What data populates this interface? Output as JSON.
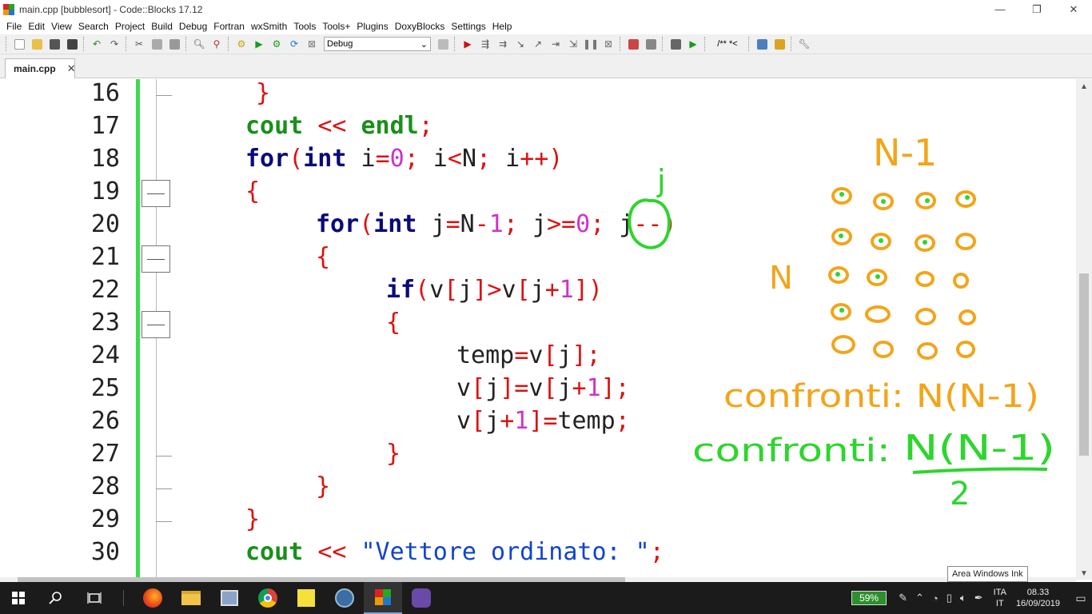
{
  "window": {
    "title": "main.cpp [bubblesort] - Code::Blocks 17.12",
    "minimize": "—",
    "restore": "❐",
    "close": "✕"
  },
  "menu": [
    "File",
    "Edit",
    "View",
    "Search",
    "Project",
    "Build",
    "Debug",
    "Fortran",
    "wxSmith",
    "Tools",
    "Tools+",
    "Plugins",
    "DoxyBlocks",
    "Settings",
    "Help"
  ],
  "toolbar": {
    "build_target": "Debug",
    "doxy_comment": "/** *<"
  },
  "tab": {
    "label": "main.cpp",
    "close": "✕"
  },
  "editor": {
    "line_numbers": [
      "16",
      "17",
      "18",
      "19",
      "20",
      "21",
      "22",
      "23",
      "24",
      "25",
      "26",
      "27",
      "28",
      "29",
      "30"
    ]
  },
  "ink": {
    "j": "j",
    "n_minus_1": "N-1",
    "n": "N",
    "formula1": "confronti: N(N-1)",
    "formula2_label": "confronti:",
    "formula2_num": "N(N-1)",
    "formula2_den": "2"
  },
  "tooltip": "Area Windows Ink",
  "taskbar": {
    "battery": "59%",
    "lang_top": "ITA",
    "lang_bottom": "IT",
    "time": "08.33",
    "date": "16/09/2019"
  },
  "colors": {
    "ink_orange": "#f2a51a",
    "ink_green": "#2ed52e",
    "change_bar": "#3ddc4b"
  }
}
